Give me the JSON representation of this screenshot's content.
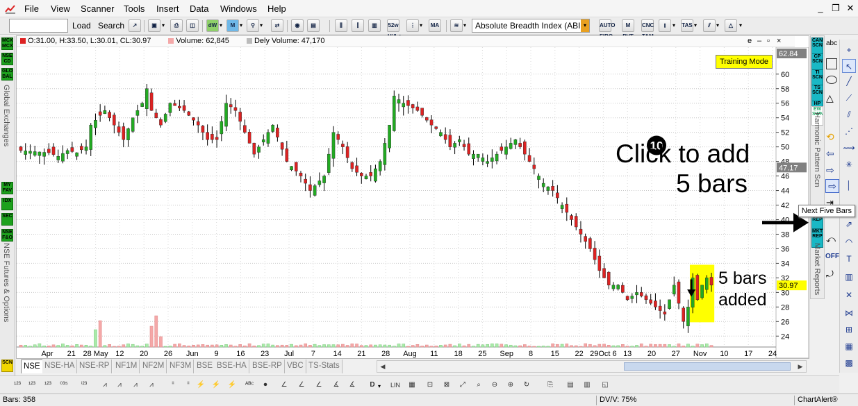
{
  "menubar": {
    "items": [
      "File",
      "View",
      "Scanner",
      "Tools",
      "Insert",
      "Data",
      "Windows",
      "Help"
    ],
    "minimize": "_",
    "restore": "❐",
    "close": "✕"
  },
  "toolbar": {
    "symbol_input_value": "",
    "load_label": "Load",
    "search_label": "Search",
    "icon_labels": [
      "dW",
      "M",
      "52w Hi/Lo",
      "MA",
      "AUTO FIBO",
      "M PVT",
      "CNC TAM",
      "TAS"
    ],
    "indicator_select": "Absolute Breadth Index (ABI",
    "dd_arrow": "▾"
  },
  "left_panel": {
    "top_buttons": [
      "MCX MCX",
      "NSE CD",
      "GLO BAL"
    ],
    "top_label": "Global Exchanges",
    "mid_buttons": [
      "MY FAV",
      "IDX",
      "SEC",
      "NSE F&O"
    ],
    "mid_label": "NSE Futures & Options",
    "bottom_button": "SCN"
  },
  "info_bar": {
    "ohlc": "O:31.00, H:33.50, L:30.01, CL:30.97",
    "volume": "Volume: 62,845",
    "dely_volume": "Dely Volume: 47,170",
    "ctrl_e": "e",
    "ctrl_min": "–",
    "ctrl_restore": "▫",
    "ctrl_close": "×"
  },
  "training_mode": "Training Mode",
  "annotations": {
    "step_number": "10",
    "click_line1": "Click to add",
    "click_line2": "5 bars",
    "added_line1": "5 bars",
    "added_line2": "added"
  },
  "chart_data": {
    "type": "candlestick",
    "y_ticks": [
      24,
      26,
      28,
      30,
      32,
      34,
      36,
      38,
      40,
      42,
      44,
      46,
      48,
      50,
      52,
      54,
      56,
      58,
      60
    ],
    "ylim": [
      22.5,
      62.84
    ],
    "axis_top_value": "62.84",
    "crosshair_value": "47.17",
    "last_close_label": "30.97",
    "x_tick_labels": [
      "Apr",
      "21",
      "28 May",
      "12",
      "20",
      "26",
      "Jun",
      "9",
      "16",
      "23",
      "Jul",
      "7",
      "14",
      "21",
      "28",
      "Aug",
      "11",
      "18",
      "25",
      "Sep",
      "8",
      "15",
      "22",
      "29Oct 6",
      "13",
      "20",
      "27",
      "Nov",
      "10",
      "17",
      "24"
    ],
    "month_dividers": [
      "Apr",
      "May",
      "Jun",
      "Jul",
      "Aug",
      "Sep",
      "Oct",
      "Nov"
    ],
    "colors": {
      "up": "#22aa22",
      "down": "#dd2222",
      "wick": "#000000",
      "vol_up": "#aaeaaa",
      "vol_down": "#f4a8a8",
      "highlight": "#ffff00"
    },
    "highlight_last_bars": 5,
    "close_waypoints": [
      [
        0,
        49.5
      ],
      [
        6,
        49.2
      ],
      [
        8,
        48.7
      ],
      [
        10,
        49.5
      ],
      [
        12,
        49.2
      ],
      [
        14,
        50
      ],
      [
        15,
        53
      ],
      [
        18,
        55
      ],
      [
        20,
        53
      ],
      [
        22,
        51
      ],
      [
        24,
        54
      ],
      [
        26,
        56
      ],
      [
        27,
        58
      ],
      [
        28,
        55
      ],
      [
        30,
        53
      ],
      [
        32,
        56
      ],
      [
        35,
        55
      ],
      [
        38,
        53
      ],
      [
        40,
        51
      ],
      [
        42,
        51
      ],
      [
        44,
        56
      ],
      [
        46,
        55
      ],
      [
        48,
        52
      ],
      [
        50,
        49
      ],
      [
        52,
        51
      ],
      [
        54,
        53
      ],
      [
        57,
        48
      ],
      [
        60,
        46
      ],
      [
        62,
        44
      ],
      [
        65,
        46
      ],
      [
        67,
        52
      ],
      [
        69,
        50
      ],
      [
        71,
        47
      ],
      [
        73,
        46
      ],
      [
        75,
        46
      ],
      [
        77,
        48
      ],
      [
        79,
        53
      ],
      [
        80,
        57
      ],
      [
        82,
        56
      ],
      [
        85,
        55
      ],
      [
        88,
        53
      ],
      [
        90,
        52
      ],
      [
        92,
        50
      ],
      [
        94,
        51
      ],
      [
        96,
        49
      ],
      [
        98,
        49
      ],
      [
        100,
        48
      ],
      [
        102,
        49
      ],
      [
        104,
        50
      ],
      [
        106,
        51
      ],
      [
        108,
        49
      ],
      [
        110,
        47
      ],
      [
        112,
        45
      ],
      [
        114,
        44
      ],
      [
        116,
        42
      ],
      [
        118,
        40
      ],
      [
        120,
        38
      ],
      [
        122,
        36
      ],
      [
        124,
        33
      ],
      [
        126,
        31
      ],
      [
        128,
        31
      ],
      [
        130,
        29
      ],
      [
        132,
        30
      ],
      [
        134,
        29
      ],
      [
        136,
        28
      ],
      [
        138,
        27
      ],
      [
        140,
        31
      ],
      [
        142,
        26
      ],
      [
        143,
        28
      ],
      [
        144,
        32
      ],
      [
        145,
        29
      ],
      [
        146,
        31
      ],
      [
        147,
        32
      ],
      [
        148,
        31
      ]
    ],
    "volume_spikes": {
      "16": 25,
      "17": 38,
      "28": 30,
      "29": 45,
      "30": 15
    }
  },
  "right_panel": {
    "buttons": [
      "CAN SCN",
      "CP SCN",
      "TI SCN",
      "TS SCN",
      "HP SCN",
      "EW SWN"
    ],
    "label1": "Harmonic Pattern Scn",
    "lower_buttons": [
      "MKT REP",
      "MKT REP"
    ],
    "label2": "Market Reports",
    "off_label": "OFF"
  },
  "draw_tools": {
    "text_tool": "abc",
    "tooltip": "Next Five Bars"
  },
  "tabs": [
    "NSE",
    "NSE-HA",
    "NSE-RP",
    "NF1M",
    "NF2M",
    "NF3M",
    "BSE",
    "BSE-HA",
    "BSE-RP",
    "VBC",
    "TS-Stats"
  ],
  "bottom_toolbar": {
    "d_label": "D",
    "lin_label": "LIN"
  },
  "status_bar": {
    "bars": "Bars: 358",
    "dvv": "DV/V: 75%",
    "brand": "ChartAlert®"
  }
}
